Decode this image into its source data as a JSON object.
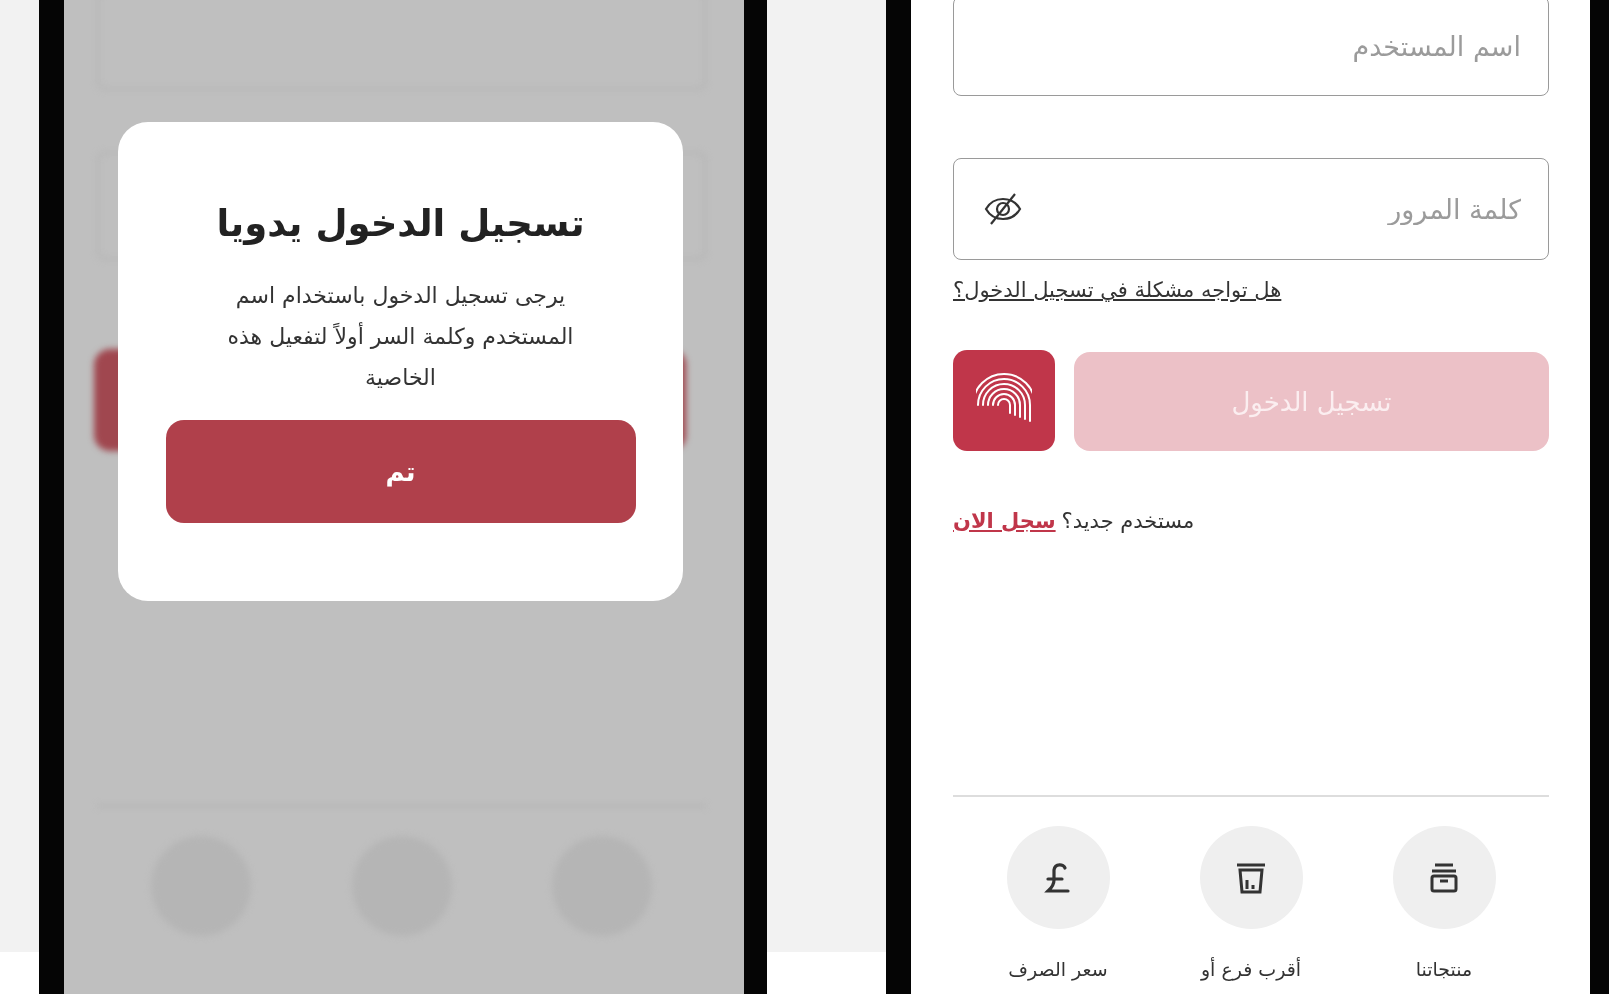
{
  "dialog": {
    "title": "تسجيل الدخول يدويا",
    "message": "يرجى تسجيل الدخول باستخدام اسم المستخدم وكلمة السر أولاً لتفعيل هذه الخاصية",
    "button": "تم"
  },
  "login": {
    "username_placeholder": "اسم المستخدم",
    "password_placeholder": "كلمة المرور",
    "trouble_link": "هل تواجه مشكلة في تسجيل الدخول؟",
    "login_button": {
      "label": "تسجيل الدخول",
      "disabled": true
    },
    "register_prompt": "مستخدم جديد؟",
    "register_link": "سجل الان"
  },
  "quick_links": [
    {
      "kind": "products",
      "label": "منتجاتنا"
    },
    {
      "kind": "branch",
      "label": "أقرب فرع أو"
    },
    {
      "kind": "currency",
      "label": "سعر الصرف"
    }
  ]
}
